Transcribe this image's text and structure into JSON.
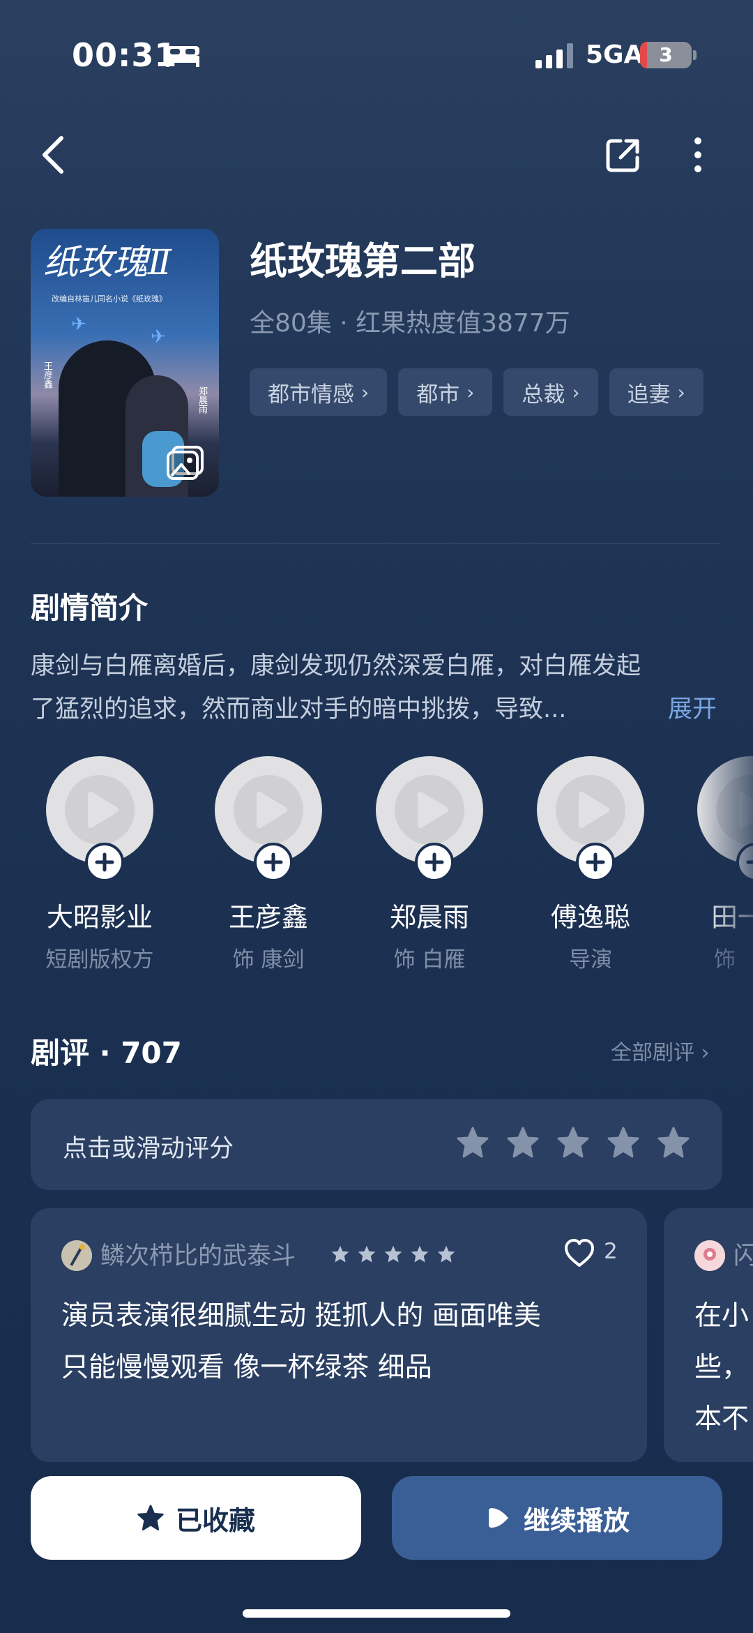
{
  "status_bar": {
    "time": "00:31",
    "network": "5GA",
    "battery": "3"
  },
  "drama": {
    "title": "纸玫瑰第二部",
    "meta": "全80集 · 红果热度值3877万",
    "tags": [
      "都市情感",
      "都市",
      "总裁",
      "追妻"
    ],
    "poster": {
      "title": "纸玫瑰Ⅱ",
      "subtitle": "改编自林笛儿同名小说《纸玫瑰》",
      "actor_left": "王彦鑫",
      "actor_right": "郑晨雨"
    }
  },
  "synopsis": {
    "heading": "剧情简介",
    "line1": "康剑与白雁离婚后，康剑发现仍然深爱白雁，对白雁发起",
    "line2": "了猛烈的追求，然而商业对手的暗中挑拨，导致...",
    "expand_label": "展开"
  },
  "cast": [
    {
      "name": "大昭影业",
      "role": "短剧版权方"
    },
    {
      "name": "王彦鑫",
      "role": "饰 康剑"
    },
    {
      "name": "郑晨雨",
      "role": "饰 白雁"
    },
    {
      "name": "傅逸聪",
      "role": "导演"
    },
    {
      "name": "田一",
      "role": "饰"
    }
  ],
  "reviews": {
    "heading": "剧评 · 707",
    "all_label": "全部剧评 ›",
    "rate_prompt": "点击或滑动评分",
    "rating_stars": 5,
    "items": [
      {
        "user": "鳞次栉比的武泰斗",
        "stars": 5,
        "likes": "2",
        "text_line1": "演员表演很细腻生动 挺抓人的 画面唯美",
        "text_line2": "只能慢慢观看 像一杯绿茶 细品"
      },
      {
        "user": "闪",
        "text_line1": "在小",
        "text_line2": "些，",
        "text_line3": "本不"
      }
    ]
  },
  "actions": {
    "favorite_label": "已收藏",
    "play_label": "继续播放"
  },
  "colors": {
    "background": "#1e3354",
    "accent": "#7aa6e0",
    "play_button": "#3a5f96",
    "tag_bg": "#34496b"
  }
}
